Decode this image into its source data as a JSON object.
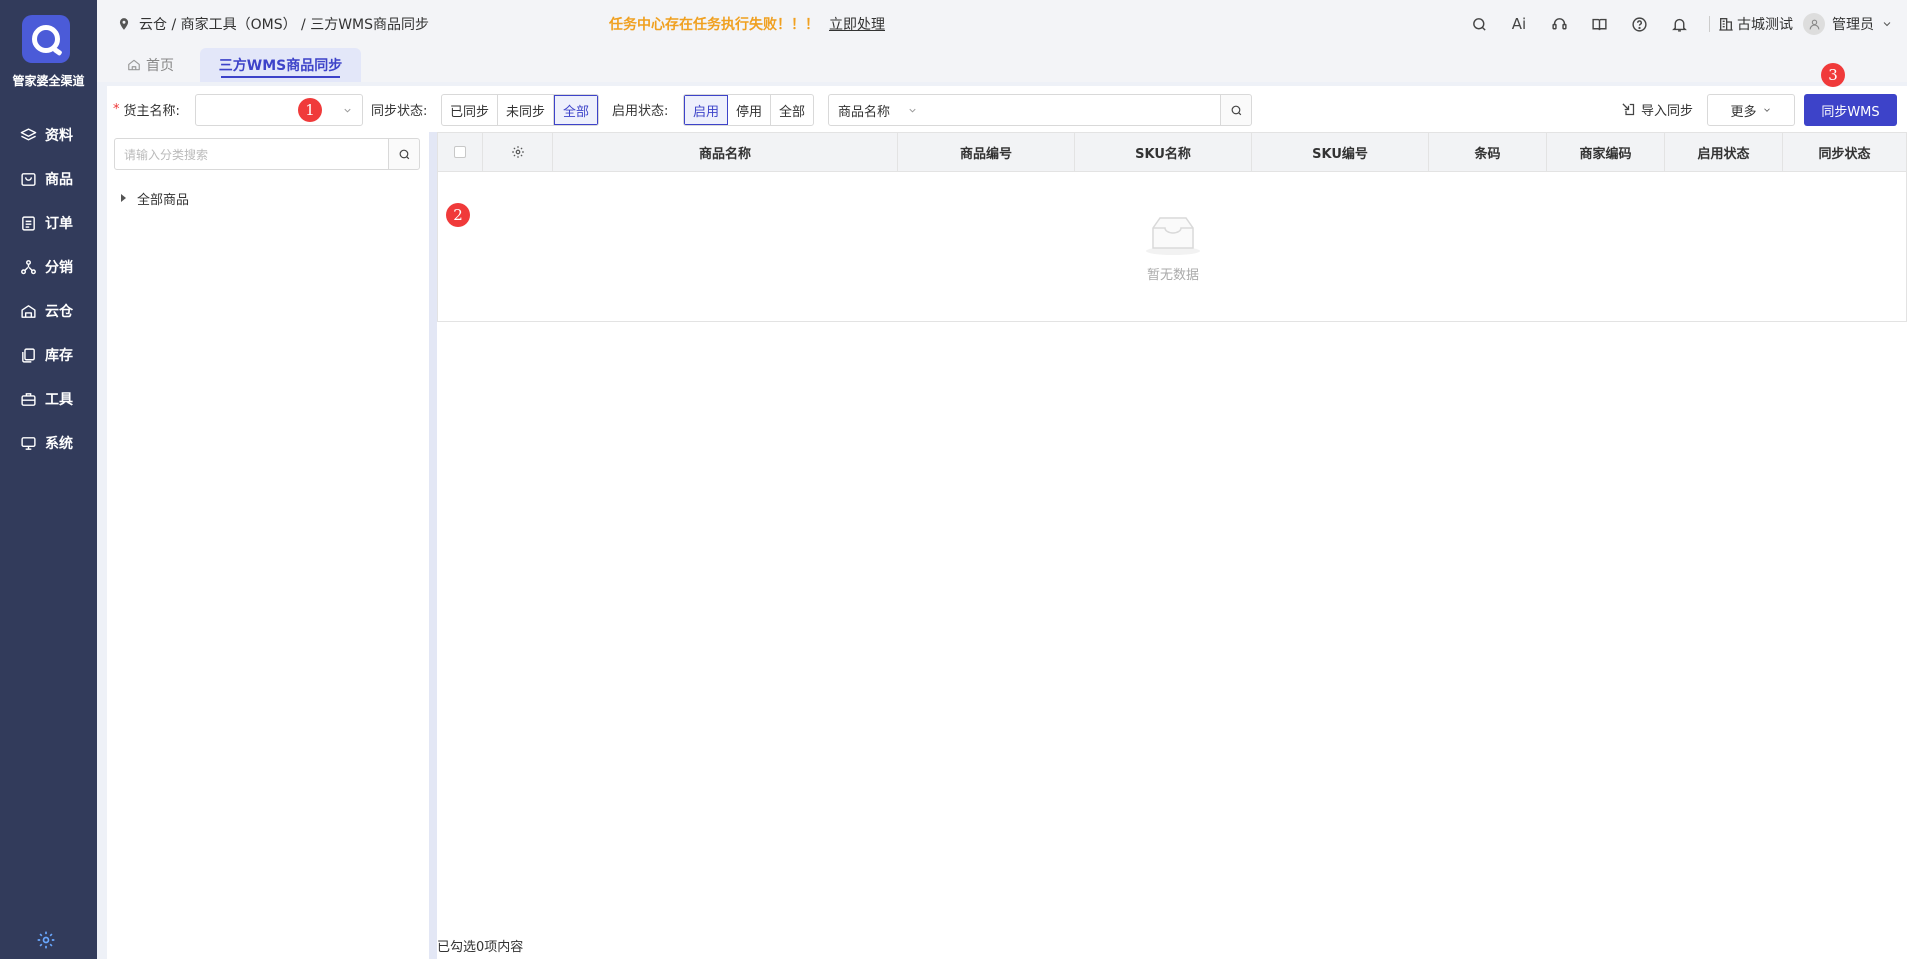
{
  "sidebar": {
    "brand": "管家婆全渠道",
    "items": [
      {
        "label": "资料",
        "icon": "layers-icon"
      },
      {
        "label": "商品",
        "icon": "bag-icon"
      },
      {
        "label": "订单",
        "icon": "document-icon"
      },
      {
        "label": "分销",
        "icon": "network-icon"
      },
      {
        "label": "云仓",
        "icon": "warehouse-icon"
      },
      {
        "label": "库存",
        "icon": "stack-icon"
      },
      {
        "label": "工具",
        "icon": "toolbox-icon"
      },
      {
        "label": "系统",
        "icon": "monitor-icon"
      }
    ],
    "bottom_icon": "gear-icon"
  },
  "topbar": {
    "breadcrumb": "云仓 / 商家工具（OMS） / 三方WMS商品同步",
    "notice": "任务中心存在任务执行失败！！！",
    "notice_link": "立即处理",
    "ai_label": "Ai",
    "company": "古城测试",
    "user": "管理员",
    "icons": [
      "search-icon",
      "ai-icon",
      "support-icon",
      "book-icon",
      "help-icon",
      "bell-icon",
      "building-icon",
      "avatar-icon"
    ]
  },
  "tabs": {
    "home": "首页",
    "active": "三方WMS商品同步"
  },
  "filters": {
    "owner_label": "货主名称:",
    "owner_value": "",
    "sync_label": "同步状态:",
    "sync_options": [
      "已同步",
      "未同步",
      "全部"
    ],
    "sync_selected": "全部",
    "enable_label": "启用状态:",
    "enable_options": [
      "启用",
      "停用",
      "全部"
    ],
    "enable_selected": "启用",
    "field_select": "商品名称",
    "search_value": "",
    "import_label": "导入同步",
    "more_label": "更多",
    "sync_button": "同步WMS"
  },
  "tree": {
    "search_placeholder": "请输入分类搜索",
    "root": "全部商品"
  },
  "table": {
    "columns": [
      "商品名称",
      "商品编号",
      "SKU名称",
      "SKU编号",
      "条码",
      "商家编码",
      "启用状态",
      "同步状态"
    ],
    "rows": [],
    "empty_text": "暂无数据",
    "footer": "已勾选0项内容"
  },
  "markers": [
    "1",
    "2",
    "3"
  ],
  "colors": {
    "sidebar_bg": "#323b5b",
    "accent": "#3d43c9",
    "warning": "#f0a020",
    "marker": "#f03a3a"
  }
}
